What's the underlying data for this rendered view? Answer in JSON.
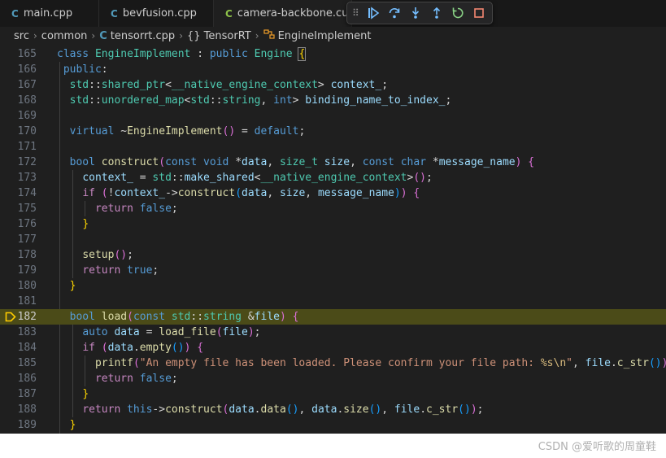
{
  "tabs": [
    {
      "icon": "C",
      "label": "main.cpp",
      "icon_color": "#519aba"
    },
    {
      "icon": "C",
      "label": "bevfusion.cpp",
      "icon_color": "#519aba"
    },
    {
      "icon": "C",
      "label": "camera-backbone.cu",
      "icon_color": "#8dc149"
    }
  ],
  "debug_toolbar": [
    "drag-grip",
    "continue",
    "step-over",
    "step-into",
    "step-out",
    "restart",
    "stop"
  ],
  "breadcrumb": [
    "src",
    "common",
    "tensorrt.cpp",
    "{} TensorRT",
    "EngineImplement"
  ],
  "editor": {
    "current_line": 182,
    "lines": [
      {
        "n": "165",
        "t": "class EngineImplement : public Engine {"
      },
      {
        "n": "166",
        "t": " public:"
      },
      {
        "n": "167",
        "t": "  std::shared_ptr<__native_engine_context> context_;"
      },
      {
        "n": "168",
        "t": "  std::unordered_map<std::string, int> binding_name_to_index_;"
      },
      {
        "n": "169",
        "t": ""
      },
      {
        "n": "170",
        "t": "  virtual ~EngineImplement() = default;"
      },
      {
        "n": "171",
        "t": ""
      },
      {
        "n": "172",
        "t": "  bool construct(const void *data, size_t size, const char *message_name) {"
      },
      {
        "n": "173",
        "t": "    context_ = std::make_shared<__native_engine_context>();"
      },
      {
        "n": "174",
        "t": "    if (!context_->construct(data, size, message_name)) {"
      },
      {
        "n": "175",
        "t": "      return false;"
      },
      {
        "n": "176",
        "t": "    }"
      },
      {
        "n": "177",
        "t": ""
      },
      {
        "n": "178",
        "t": "    setup();"
      },
      {
        "n": "179",
        "t": "    return true;"
      },
      {
        "n": "180",
        "t": "  }"
      },
      {
        "n": "181",
        "t": ""
      },
      {
        "n": "182",
        "t": "  bool load(const std::string &file) {"
      },
      {
        "n": "183",
        "t": "    auto data = load_file(file);"
      },
      {
        "n": "184",
        "t": "    if (data.empty()) {"
      },
      {
        "n": "185",
        "t": "      printf(\"An empty file has been loaded. Please confirm your file path: %s\\n\", file.c_str());"
      },
      {
        "n": "186",
        "t": "      return false;"
      },
      {
        "n": "187",
        "t": "    }"
      },
      {
        "n": "188",
        "t": "    return this->construct(data.data(), data.size(), file.c_str());"
      },
      {
        "n": "189",
        "t": "  }"
      }
    ]
  },
  "watermark": "CSDN @爱听歌的周童鞋"
}
